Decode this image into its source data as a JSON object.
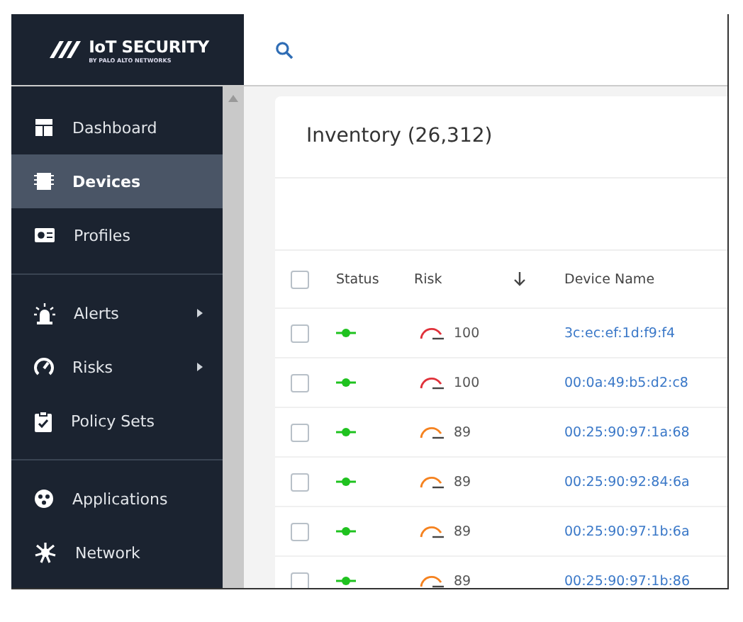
{
  "brand": {
    "name": "IoT SECURITY",
    "tagline": "BY PALO ALTO NETWORKS"
  },
  "sidebar": {
    "sections": [
      [
        {
          "label": "Dashboard",
          "selected": false,
          "submenu": false
        },
        {
          "label": "Devices",
          "selected": true,
          "submenu": false
        },
        {
          "label": "Profiles",
          "selected": false,
          "submenu": false
        }
      ],
      [
        {
          "label": "Alerts",
          "selected": false,
          "submenu": true
        },
        {
          "label": "Risks",
          "selected": false,
          "submenu": true
        },
        {
          "label": "Policy Sets",
          "selected": false,
          "submenu": false
        }
      ],
      [
        {
          "label": "Applications",
          "selected": false,
          "submenu": false
        },
        {
          "label": "Network",
          "selected": false,
          "submenu": false
        }
      ]
    ]
  },
  "inventory": {
    "title": "Inventory (26,312)",
    "table": {
      "select_all": {
        "checked": false
      },
      "columns": [
        "Status",
        "Risk",
        "Device Name"
      ],
      "rows": [
        {
          "checked": false,
          "status": {
            "color": "#1fc21f"
          },
          "risk": {
            "value": "100",
            "color": "#e0313a"
          },
          "device_name": "3c:ec:ef:1d:f9:f4"
        },
        {
          "checked": false,
          "status": {
            "color": "#1fc21f"
          },
          "risk": {
            "value": "100",
            "color": "#e0313a"
          },
          "device_name": "00:0a:49:b5:d2:c8"
        },
        {
          "checked": false,
          "status": {
            "color": "#1fc21f"
          },
          "risk": {
            "value": "89",
            "color": "#f5821f"
          },
          "device_name": "00:25:90:97:1a:68"
        },
        {
          "checked": false,
          "status": {
            "color": "#1fc21f"
          },
          "risk": {
            "value": "89",
            "color": "#f5821f"
          },
          "device_name": "00:25:90:92:84:6a"
        },
        {
          "checked": false,
          "status": {
            "color": "#1fc21f"
          },
          "risk": {
            "value": "89",
            "color": "#f5821f"
          },
          "device_name": "00:25:90:97:1b:6a"
        },
        {
          "checked": false,
          "status": {
            "color": "#1fc21f"
          },
          "risk": {
            "value": "89",
            "color": "#f5821f"
          },
          "device_name": "00:25:90:97:1b:86"
        }
      ]
    }
  }
}
